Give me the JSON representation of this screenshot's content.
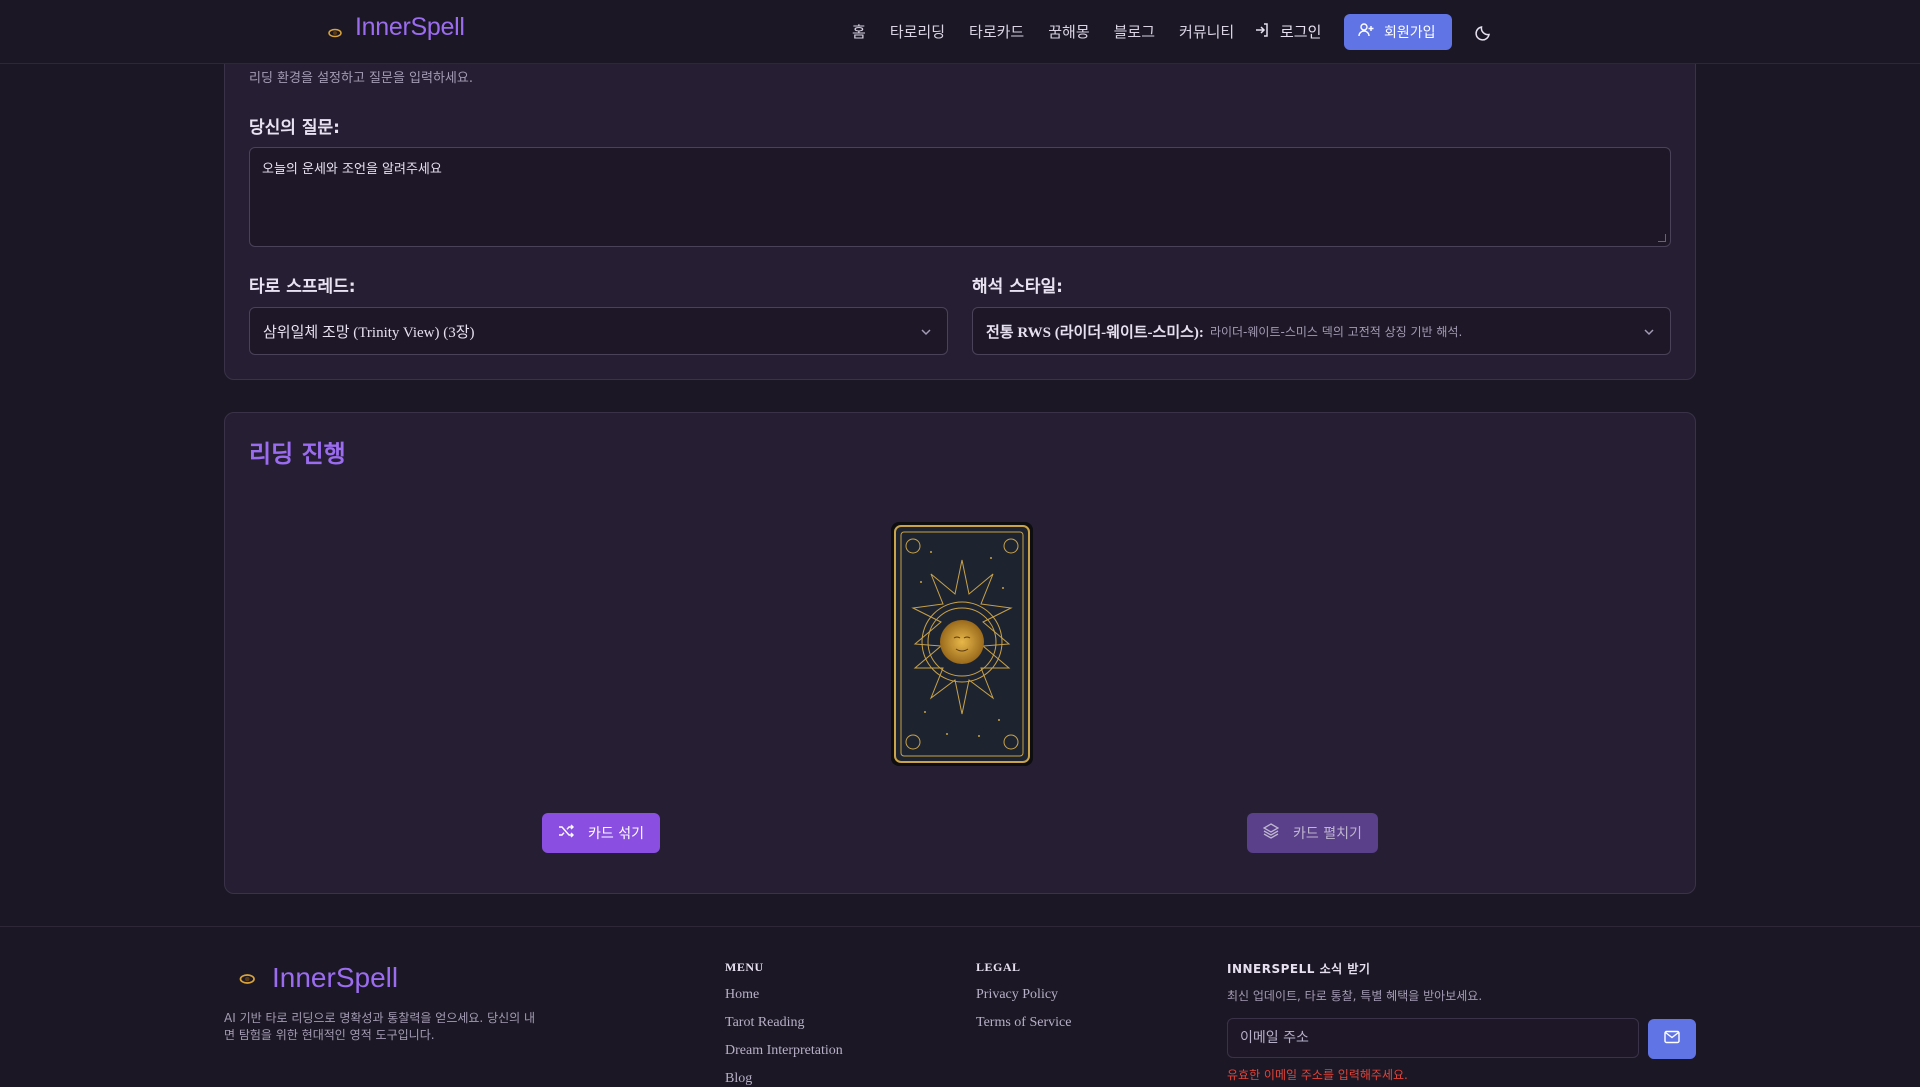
{
  "header": {
    "logo_text": "InnerSpell",
    "nav": [
      "홈",
      "타로리딩",
      "타로카드",
      "꿈해몽",
      "블로그",
      "커뮤니티"
    ],
    "login_label": "로그인",
    "signup_label": "회원가입"
  },
  "settings": {
    "subtitle": "리딩 환경을 설정하고 질문을 입력하세요.",
    "question_label": "당신의 질문:",
    "question_value": "오늘의 운세와 조언을 알려주세요",
    "spread_label": "타로 스프레드:",
    "spread_value": "삼위일체 조망 (Trinity View) (3장)",
    "style_label": "해석 스타일:",
    "style_value": "전통 RWS (라이더-웨이트-스미스):",
    "style_desc": "라이더-웨이트-스미스 덱의 고전적 상징 기반 해석."
  },
  "reading": {
    "title": "리딩 진행",
    "shuffle_label": "카드 섞기",
    "spread_label": "카드 펼치기"
  },
  "footer": {
    "logo_text": "InnerSpell",
    "description": "AI 기반 타로 리딩으로 명확성과 통찰력을 얻으세요. 당신의 내면 탐험을 위한 현대적인 영적 도구입니다.",
    "menu_heading": "MENU",
    "menu_links": [
      "Home",
      "Tarot Reading",
      "Dream Interpretation",
      "Blog"
    ],
    "legal_heading": "LEGAL",
    "legal_links": [
      "Privacy Policy",
      "Terms of Service"
    ],
    "newsletter_heading": "INNERSPELL 소식 받기",
    "newsletter_desc": "최신 업데이트, 타로 통찰, 특별 혜택을 받아보세요.",
    "email_placeholder": "이메일 주소",
    "email_error": "유효한 이메일 주소를 입력해주세요."
  },
  "colors": {
    "background": "#1b1724",
    "card": "#261f33",
    "brand_purple": "#9b6cf0",
    "primary_blue": "#6074e6",
    "error": "#e0443a"
  },
  "icons": [
    "login-icon",
    "user-plus-icon",
    "moon-icon",
    "chevron-down-icon",
    "shuffle-icon",
    "layers-icon",
    "mail-icon",
    "eye-moon-logo-icon"
  ]
}
